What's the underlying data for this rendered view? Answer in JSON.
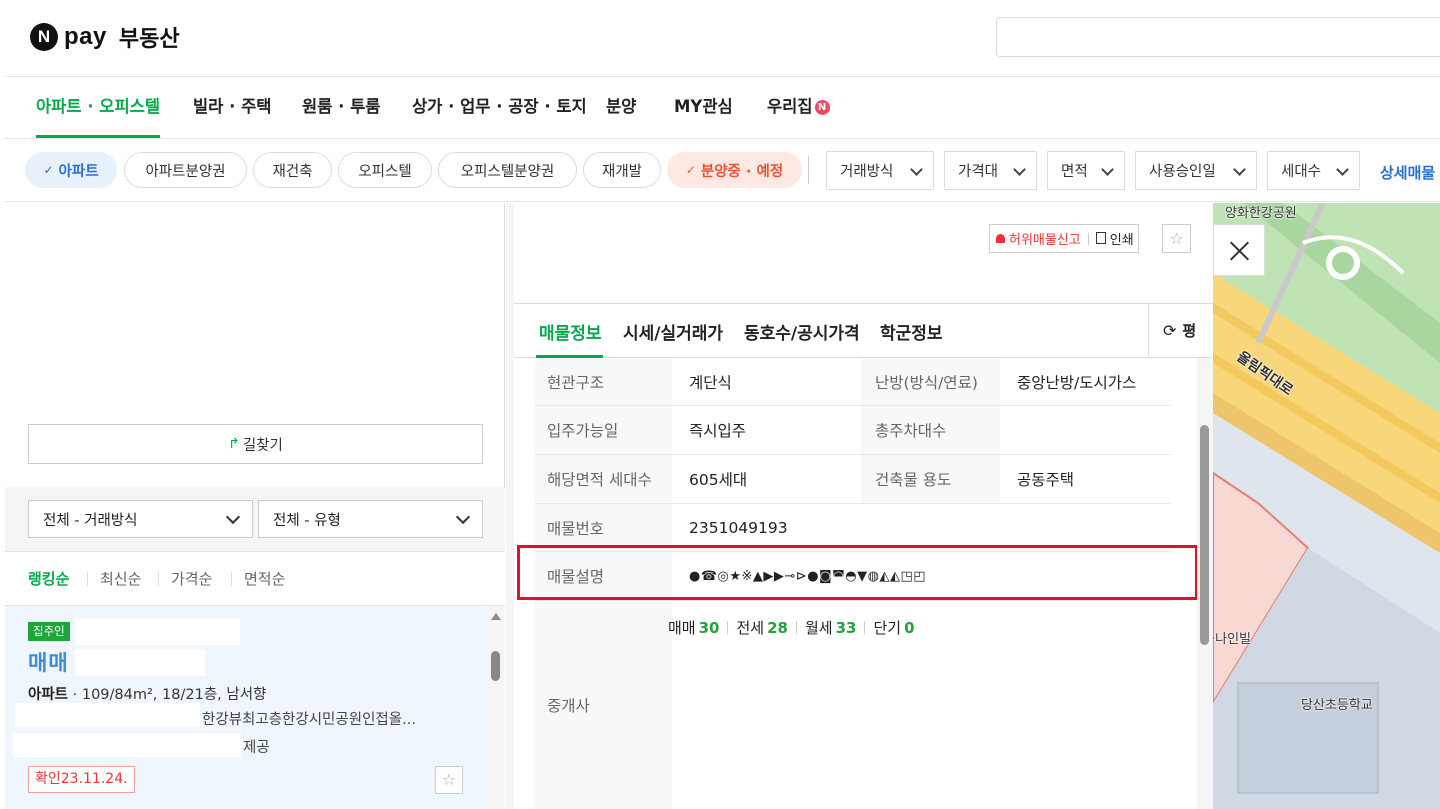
{
  "header": {
    "logo_n": "N",
    "logo_pay": "pay",
    "logo_brand": "부동산",
    "search_placeholder": ""
  },
  "nav": {
    "tabs": [
      {
        "label": "아파트 · 오피스텔",
        "active": true
      },
      {
        "label": "빌라 · 주택"
      },
      {
        "label": "원룸 · 투룸"
      },
      {
        "label": "상가 · 업무 · 공장 · 토지"
      },
      {
        "label": "분양"
      },
      {
        "label": "MY관심"
      },
      {
        "label": "우리집"
      }
    ],
    "new_badge": "N"
  },
  "filters": {
    "chips": [
      {
        "label": "아파트",
        "selected": true,
        "check": "✓"
      },
      {
        "label": "아파트분양권"
      },
      {
        "label": "재건축"
      },
      {
        "label": "오피스텔"
      },
      {
        "label": "오피스텔분양권"
      },
      {
        "label": "재개발"
      },
      {
        "label": "분양중 · 예정",
        "selected": true,
        "check": "✓"
      }
    ],
    "dropdowns": [
      "거래방식",
      "가격대",
      "면적",
      "사용승인일",
      "세대수"
    ],
    "detail_label": "상세매물"
  },
  "left": {
    "route_icon": "↱",
    "route_label": "길찾기",
    "select_trade": "전체 - 거래방식",
    "select_type": "전체 - 유형",
    "sort": [
      "랭킹순",
      "최신순",
      "가격순",
      "면적순"
    ],
    "listing": {
      "owner_badge": "집주인",
      "deal_type": "매매",
      "spec_type": "아파트",
      "spec_rest": " · 109/84m², 18/21층, 남서향",
      "desc": "한강뷰최고층한강시민공원인접올...",
      "provider": "제공",
      "confirm": "확인23.11.24.",
      "star": "☆"
    }
  },
  "detail": {
    "report_label": "허위매물신고",
    "print_label": "인쇄",
    "star": "☆",
    "tabs": [
      "매물정보",
      "시세/실거래가",
      "동호수/공시가격",
      "학군정보"
    ],
    "refresh_icon": "⟳",
    "refresh_label": "평",
    "rows": [
      {
        "l": "현관구조",
        "v": "계단식",
        "l2": "난방(방식/연료)",
        "v2": "중앙난방/도시가스"
      },
      {
        "l": "입주가능일",
        "v": "즉시입주",
        "l2": "총주차대수",
        "v2": ""
      },
      {
        "l": "해당면적 세대수",
        "v": "605세대",
        "l2": "건축물 용도",
        "v2": "공동주택"
      },
      {
        "l": "매물번호",
        "v": "2351049193"
      },
      {
        "l": "매물설명",
        "v": "●☎◎★※▲▶▶⊸⊳●◙◚◓▼◍◭◭◳◰"
      },
      {
        "l": "중개사",
        "v": ""
      }
    ],
    "broker_counts": [
      {
        "label": "매매",
        "n": "30"
      },
      {
        "label": "전세",
        "n": "28"
      },
      {
        "label": "월세",
        "n": "33"
      },
      {
        "label": "단기",
        "n": "0"
      }
    ]
  },
  "map": {
    "labels": [
      "양화한강공원",
      "올림픽대로",
      "당산초등학교",
      "·나인빌"
    ],
    "colors": {
      "road": "#f7d77a",
      "park": "#bfe3b4",
      "block": "#f8d8d3",
      "water": "#dfe5ec"
    }
  },
  "colors": {
    "accent_green": "#03a94c",
    "accent_blue": "#2a6fd1",
    "highlight_red": "#e3111b"
  }
}
